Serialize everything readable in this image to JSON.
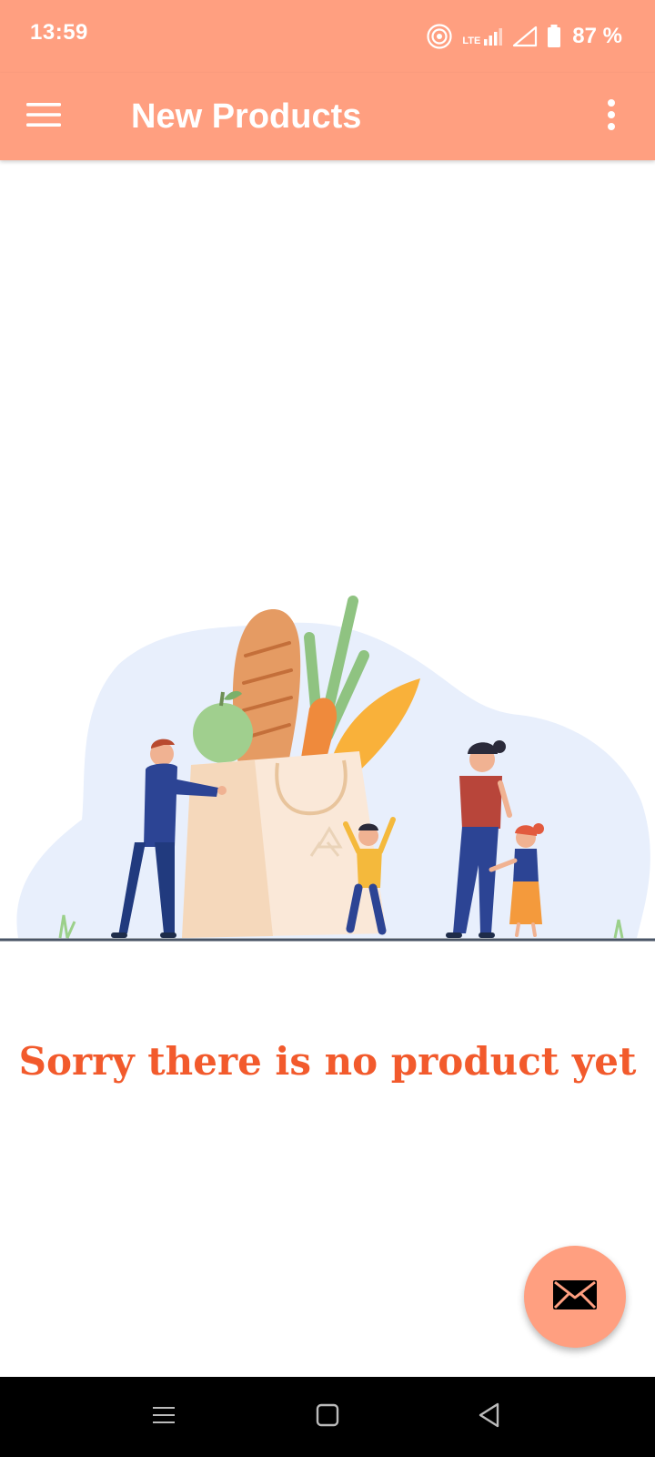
{
  "status_bar": {
    "time": "13:59",
    "network": "LTE",
    "battery_percent": "87 %",
    "icons": [
      "hotspot-icon",
      "lte-signal-icon",
      "signal-icon",
      "battery-icon"
    ]
  },
  "app_bar": {
    "title": "New Products",
    "menu_icon": "hamburger-menu-icon",
    "overflow_icon": "more-vert-icon"
  },
  "empty_state": {
    "message": "Sorry there is no product yet"
  },
  "fab": {
    "icon": "mail-icon"
  },
  "nav_bar": {
    "buttons": [
      "recents-icon",
      "home-icon",
      "back-icon"
    ]
  },
  "colors": {
    "primary": "#ff9f80",
    "message": "#f25a2c",
    "nav_bar": "#000000"
  }
}
